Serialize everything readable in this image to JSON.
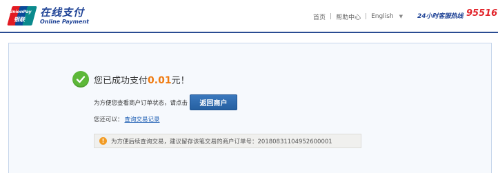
{
  "header": {
    "logo_brand_en": "UnionPay",
    "logo_brand_cn": "银联",
    "logo_title_cn": "在线支付",
    "logo_title_en": "Online Payment",
    "nav": {
      "home": "首页",
      "help": "帮助中心",
      "language": "English",
      "separator": "|"
    },
    "hotline_label": "24小时客服热线",
    "hotline_number": "95516"
  },
  "main": {
    "success_prefix": "您已成功支付",
    "success_amount": "0.01",
    "success_suffix": "元！",
    "return_text": "为方便您查看商户订单状态，请点击",
    "return_button": "返回商户",
    "query_prefix": "您还可以：",
    "query_link": "查询交易记录",
    "notice_text": "为方便后续查询交易，建议留存该笔交易的商户订单号：20180831104952600001"
  },
  "colors": {
    "brand_blue": "#1f4396",
    "amount_orange": "#f07b11",
    "hotline_red": "#e2232a",
    "success_green": "#5db839",
    "button_blue": "#2b66a8"
  },
  "icons": {
    "success": "check-circle-icon",
    "info": "info-icon",
    "dropdown": "chevron-down-icon"
  }
}
